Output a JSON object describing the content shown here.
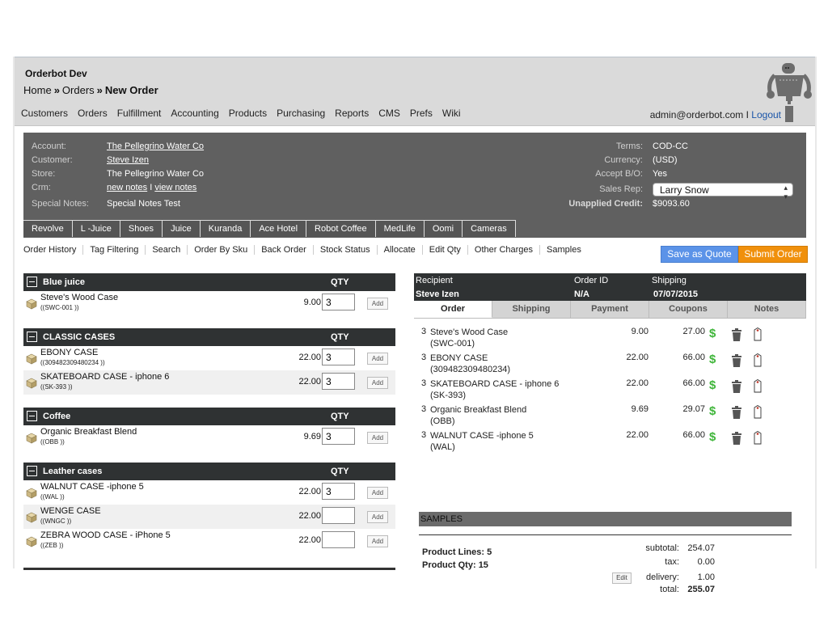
{
  "header": {
    "app_title": "Orderbot Dev",
    "breadcrumb": [
      "Home",
      "Orders",
      "New Order"
    ],
    "breadcrumb_separator": "»",
    "nav": [
      "Customers",
      "Orders",
      "Fulfillment",
      "Accounting",
      "Products",
      "Purchasing",
      "Reports",
      "CMS",
      "Prefs",
      "Wiki"
    ],
    "user_email": "admin@orderbot.com",
    "user_sep": " I ",
    "logout": "Logout"
  },
  "account": {
    "labels": {
      "account": "Account:",
      "customer": "Customer:",
      "store": "Store:",
      "crm": "Crm:",
      "special_notes": "Special Notes:"
    },
    "account": "The Pellegrino Water Co",
    "customer": "Steve Izen",
    "store": "The Pellegrino Water Co",
    "crm_new": "new notes",
    "crm_sep": " I ",
    "crm_view": "view notes",
    "special_notes": "Special Notes Test",
    "right_labels": {
      "terms": "Terms:",
      "currency": "Currency:",
      "accept_bo": "Accept B/O:",
      "sales_rep": "Sales Rep:",
      "unapplied_credit": "Unapplied Credit:"
    },
    "terms": "COD-CC",
    "currency": "(USD)",
    "accept_bo": "Yes",
    "sales_rep": "Larry Snow",
    "unapplied_credit": "$9093.60"
  },
  "category_tabs": [
    "Revolve",
    "L -Juice",
    "Shoes",
    "Juice",
    "Kuranda",
    "Ace Hotel",
    "Robot Coffee",
    "MedLife",
    "Oomi",
    "Cameras"
  ],
  "toolbar": {
    "links": [
      "Order History",
      "Tag Filtering",
      "Search",
      "Order By Sku",
      "Back Order",
      "Stock Status",
      "Allocate",
      "Edit Qty",
      "Other Charges",
      "Samples"
    ],
    "save_quote": "Save as Quote",
    "submit_order": "Submit Order"
  },
  "catalog": {
    "qty_header": "QTY",
    "add_label": "Add",
    "groups": [
      {
        "name": "Blue juice",
        "items": [
          {
            "name": "Steve's Wood Case",
            "sku": "((SWC-001 ))",
            "price": "9.00",
            "qty": "3"
          }
        ]
      },
      {
        "name": "CLASSIC CASES",
        "items": [
          {
            "name": "EBONY CASE",
            "sku": "((309482309480234 ))",
            "price": "22.00",
            "qty": "3"
          },
          {
            "name": "SKATEBOARD CASE - iphone 6",
            "sku": "((SK-393 ))",
            "price": "22.00",
            "qty": "3"
          }
        ]
      },
      {
        "name": "Coffee",
        "items": [
          {
            "name": "Organic Breakfast Blend",
            "sku": "((OBB ))",
            "price": "9.69",
            "qty": "3"
          }
        ]
      },
      {
        "name": "Leather cases",
        "items": [
          {
            "name": "WALNUT CASE -iphone 5",
            "sku": "((WAL ))",
            "price": "22.00",
            "qty": "3"
          },
          {
            "name": "WENGE CASE",
            "sku": "((WNGC ))",
            "price": "22.00",
            "qty": ""
          },
          {
            "name": "ZEBRA WOOD CASE - iPhone 5",
            "sku": "((ZEB ))",
            "price": "22.00",
            "qty": ""
          }
        ]
      }
    ]
  },
  "order": {
    "header_labels": {
      "recipient": "Recipient",
      "order_id": "Order ID",
      "shipping": "Shipping"
    },
    "recipient": "Steve Izen",
    "order_id": "N/A",
    "shipping_date": "07/07/2015",
    "tabs": [
      "Order",
      "Shipping",
      "Payment",
      "Coupons",
      "Notes"
    ],
    "active_tab": "Order",
    "lines": [
      {
        "qty": "3",
        "name": "Steve's Wood Case",
        "sku": "(SWC-001)",
        "unit": "9.00",
        "total": "27.00"
      },
      {
        "qty": "3",
        "name": "EBONY CASE",
        "sku": "(309482309480234)",
        "unit": "22.00",
        "total": "66.00"
      },
      {
        "qty": "3",
        "name": "SKATEBOARD CASE - iphone 6",
        "sku": "(SK-393)",
        "unit": "22.00",
        "total": "66.00"
      },
      {
        "qty": "3",
        "name": "Organic Breakfast Blend",
        "sku": "(OBB)",
        "unit": "9.69",
        "total": "29.07"
      },
      {
        "qty": "3",
        "name": "WALNUT CASE -iphone 5",
        "sku": "(WAL)",
        "unit": "22.00",
        "total": "66.00"
      }
    ],
    "samples_label": "SAMPLES",
    "product_lines_label": "Product Lines:",
    "product_lines": "5",
    "product_qty_label": "Product Qty:",
    "product_qty": "15",
    "totals": {
      "subtotal_label": "subtotal:",
      "subtotal": "254.07",
      "tax_label": "tax:",
      "tax": "0.00",
      "delivery_label": "delivery:",
      "delivery": "1.00",
      "total_label": "total:",
      "total": "255.07",
      "edit_label": "Edit"
    }
  },
  "colors": {
    "save_quote": "#5b93e8",
    "submit_order": "#f0900c",
    "dollar": "#3fb53a",
    "dark_header": "#2f3233",
    "account_panel": "#606060"
  }
}
